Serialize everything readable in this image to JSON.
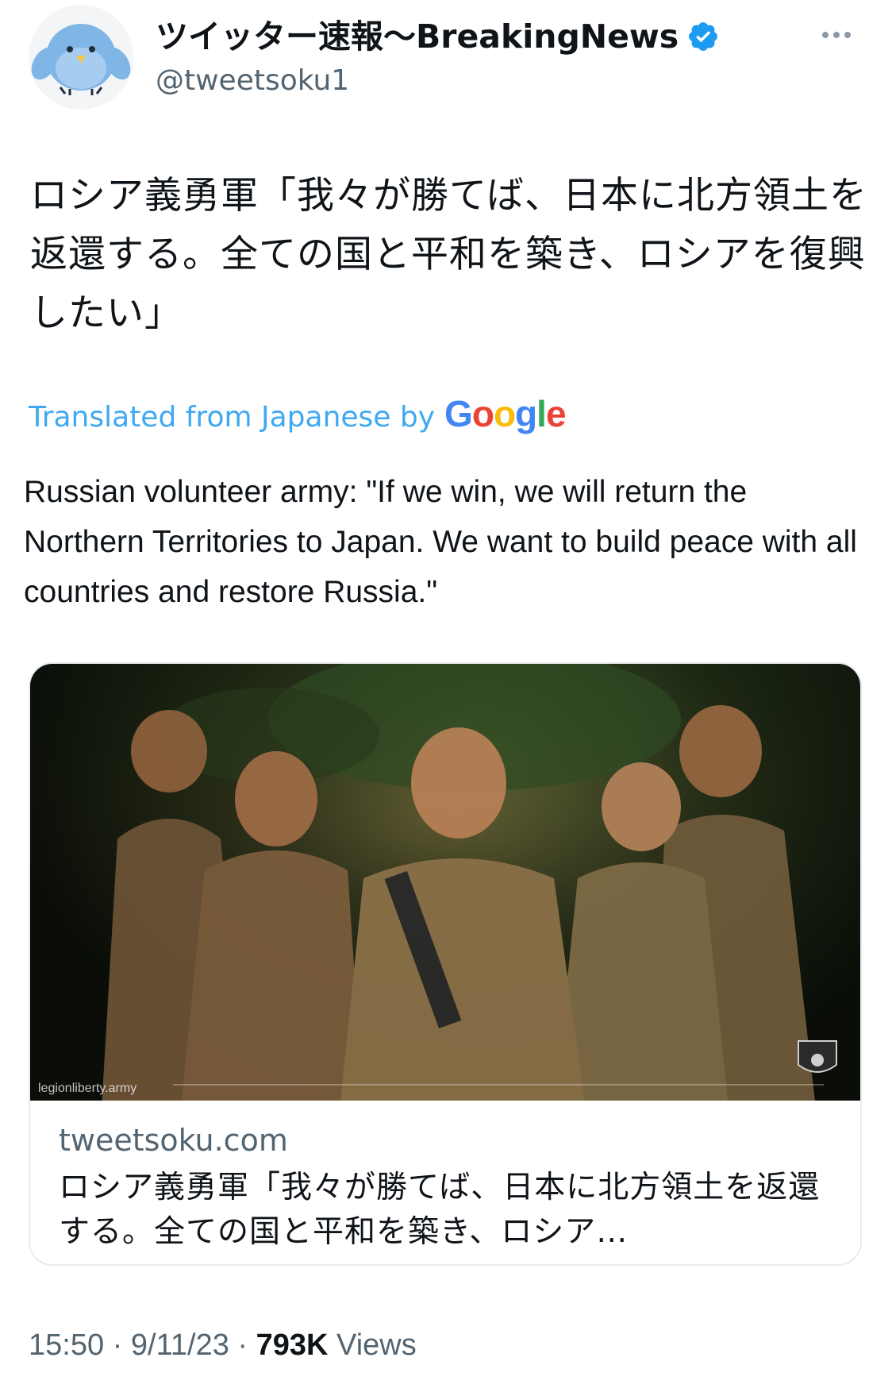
{
  "author": {
    "display_name": "ツイッター速報〜BreakingNews",
    "handle": "@tweetsoku1",
    "verified": true
  },
  "tweet": {
    "text_ja": "ロシア義勇軍「我々が勝てば、日本に北方領土を返還する。全ての国と平和を築き、ロシアを復興したい」",
    "translated_label": "Translated from Japanese by",
    "translation_provider": "Google",
    "text_en": "Russian volunteer army: \"If we win, we will return the Northern Territories to Japan. We want to build peace with all countries and restore Russia.\""
  },
  "card": {
    "image_watermark": "legionliberty.army",
    "domain": "tweetsoku.com",
    "title": "ロシア義勇軍「我々が勝てば、日本に北方領土を返還する。全ての国と平和を築き、ロシア…"
  },
  "meta": {
    "time": "15:50",
    "separator": "·",
    "date": "9/11/23",
    "views_count": "793K",
    "views_label": "Views"
  },
  "colors": {
    "link": "#1d9bf0",
    "verified": "#1d9bf0",
    "text": "#0f1419",
    "secondary": "#536471"
  },
  "icons": {
    "avatar": "blue-bird-avatar",
    "verified": "verified-badge-icon",
    "more": "more-options-icon"
  }
}
